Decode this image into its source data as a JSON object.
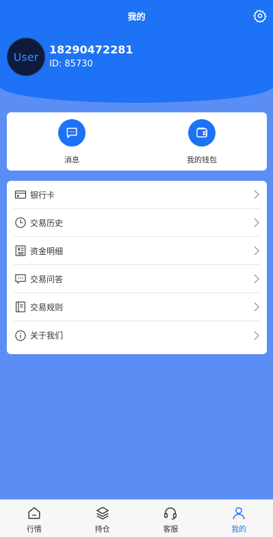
{
  "header": {
    "title": "我的"
  },
  "profile": {
    "avatar_text": "User",
    "phone": "18290472281",
    "id_label": "ID:  85730"
  },
  "quick_actions": [
    {
      "label": "消息",
      "icon": "message-icon"
    },
    {
      "label": "我的钱包",
      "icon": "wallet-icon"
    }
  ],
  "menu": [
    {
      "label": "银行卡",
      "icon": "bank-card-icon"
    },
    {
      "label": "交易历史",
      "icon": "clock-icon"
    },
    {
      "label": "资金明细",
      "icon": "fund-detail-icon"
    },
    {
      "label": "交易问答",
      "icon": "chat-bubble-icon"
    },
    {
      "label": "交易规则",
      "icon": "book-icon"
    },
    {
      "label": "关于我们",
      "icon": "info-icon"
    }
  ],
  "tabs": [
    {
      "label": "行情",
      "icon": "market-icon",
      "active": false
    },
    {
      "label": "持仓",
      "icon": "layers-icon",
      "active": false
    },
    {
      "label": "客服",
      "icon": "headset-icon",
      "active": false
    },
    {
      "label": "我的",
      "icon": "user-icon",
      "active": true
    }
  ],
  "colors": {
    "primary": "#1d72f5",
    "page_bg": "#5b8ef5",
    "avatar_bg": "#0f1b3d"
  }
}
